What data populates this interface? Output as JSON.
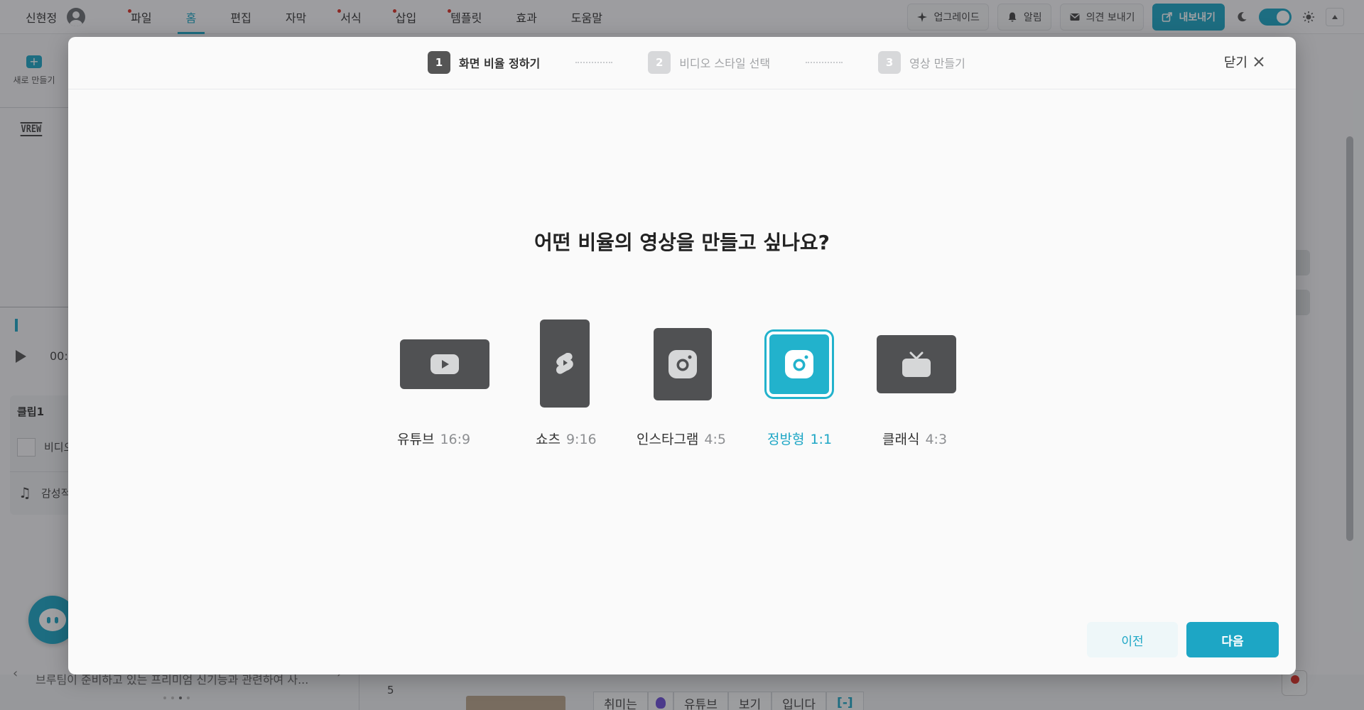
{
  "topbar": {
    "user_name": "신현정",
    "menu": [
      {
        "label": "파일",
        "dot": true
      },
      {
        "label": "홈",
        "active": true
      },
      {
        "label": "편집"
      },
      {
        "label": "자막"
      },
      {
        "label": "서식",
        "dot": true
      },
      {
        "label": "삽입",
        "dot": true
      },
      {
        "label": "템플릿",
        "dot": true
      },
      {
        "label": "효과"
      },
      {
        "label": "도움말"
      }
    ],
    "upgrade_label": "업그레이드",
    "alert_label": "알림",
    "feedback_label": "의견 보내기",
    "export_label": "내보내기"
  },
  "background": {
    "new_label": "새로 만들기",
    "logo_text": "VREW",
    "time_text": "00:",
    "clip_title": "클립1",
    "clip_video": "비디오",
    "clip_music": "감성적",
    "bottom_text": "브루팀이 준비하고 있는 프리미엄 신기능과 관련하여 사...",
    "row_number": "5",
    "words": [
      "취미는",
      "",
      "유튜브",
      "보기",
      "입니다",
      "[-]"
    ]
  },
  "modal": {
    "steps": [
      {
        "num": "1",
        "label": "화면 비율 정하기"
      },
      {
        "num": "2",
        "label": "비디오 스타일 선택"
      },
      {
        "num": "3",
        "label": "영상 만들기"
      }
    ],
    "close_label": "닫기",
    "question": "어떤 비율의 영상을 만들고 싶나요?",
    "options": [
      {
        "name": "유튜브",
        "ratio": "16:9",
        "icon": "youtube-icon"
      },
      {
        "name": "쇼츠",
        "ratio": "9:16",
        "icon": "shorts-icon"
      },
      {
        "name": "인스타그램",
        "ratio": "4:5",
        "icon": "instagram-icon"
      },
      {
        "name": "정방형",
        "ratio": "1:1",
        "icon": "instagram-icon",
        "selected": true
      },
      {
        "name": "클래식",
        "ratio": "4:3",
        "icon": "tv-icon"
      }
    ],
    "prev_label": "이전",
    "next_label": "다음"
  },
  "colors": {
    "accent": "#1da6c5",
    "tile": "#505153",
    "notification_dot": "#d93025"
  }
}
